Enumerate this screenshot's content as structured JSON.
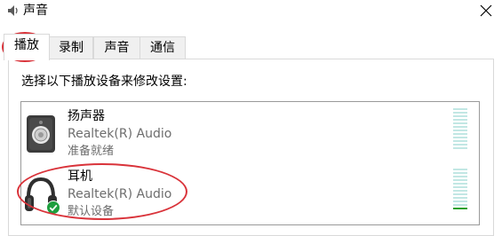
{
  "window": {
    "title": "声音",
    "icon": "speaker-app-icon",
    "close_icon": "close-icon"
  },
  "tabs": [
    {
      "label": "播放",
      "active": true
    },
    {
      "label": "录制",
      "active": false
    },
    {
      "label": "声音",
      "active": false
    },
    {
      "label": "通信",
      "active": false
    }
  ],
  "instruction": "选择以下播放设备来修改设置:",
  "devices": [
    {
      "name": "扬声器",
      "driver": "Realtek(R) Audio",
      "status": "准备就绪",
      "icon": "speaker-icon",
      "level": 0
    },
    {
      "name": "耳机",
      "driver": "Realtek(R) Audio",
      "status": "默认设备",
      "icon": "headphones-icon",
      "badge": "default-checkmark-icon",
      "level": 0.1
    }
  ],
  "colors": {
    "annotation": "#d9333a",
    "meter_empty": "#c2e7e4",
    "meter_active": "#2aa02a",
    "default_badge": "#1e9e3e"
  }
}
